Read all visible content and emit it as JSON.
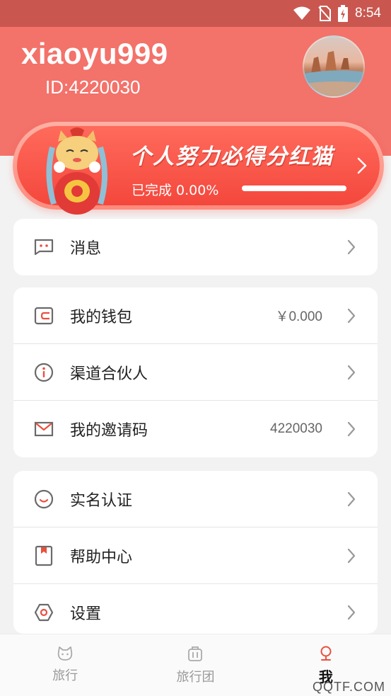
{
  "status_bar": {
    "time": "8:54"
  },
  "profile": {
    "username": "xiaoyu999",
    "id_text": "ID:4220030"
  },
  "banner": {
    "title": "个人努力必得分红猫",
    "progress_label": "已完成 0.00%",
    "progress": 0.0
  },
  "menu": {
    "group1": [
      {
        "label": "消息",
        "icon": "message-icon"
      }
    ],
    "group2": [
      {
        "label": "我的钱包",
        "value": "￥0.000",
        "icon": "wallet-icon"
      },
      {
        "label": "渠道合伙人",
        "icon": "info-icon"
      },
      {
        "label": "我的邀请码",
        "value": "4220030",
        "icon": "mail-icon"
      }
    ],
    "group3": [
      {
        "label": "实名认证",
        "icon": "smile-icon"
      },
      {
        "label": "帮助中心",
        "icon": "book-icon"
      },
      {
        "label": "设置",
        "icon": "hexagon-settings-icon"
      }
    ]
  },
  "bottom_nav": [
    {
      "label": "旅行",
      "icon": "cat-icon"
    },
    {
      "label": "旅行团",
      "icon": "suitcase-icon"
    },
    {
      "label": "我",
      "icon": "profile-icon",
      "active": true
    }
  ],
  "watermark": "QQTF.COM",
  "colors": {
    "accent": "#f3726a",
    "banner": "#f4473c",
    "icon": "#6a6a6a"
  }
}
